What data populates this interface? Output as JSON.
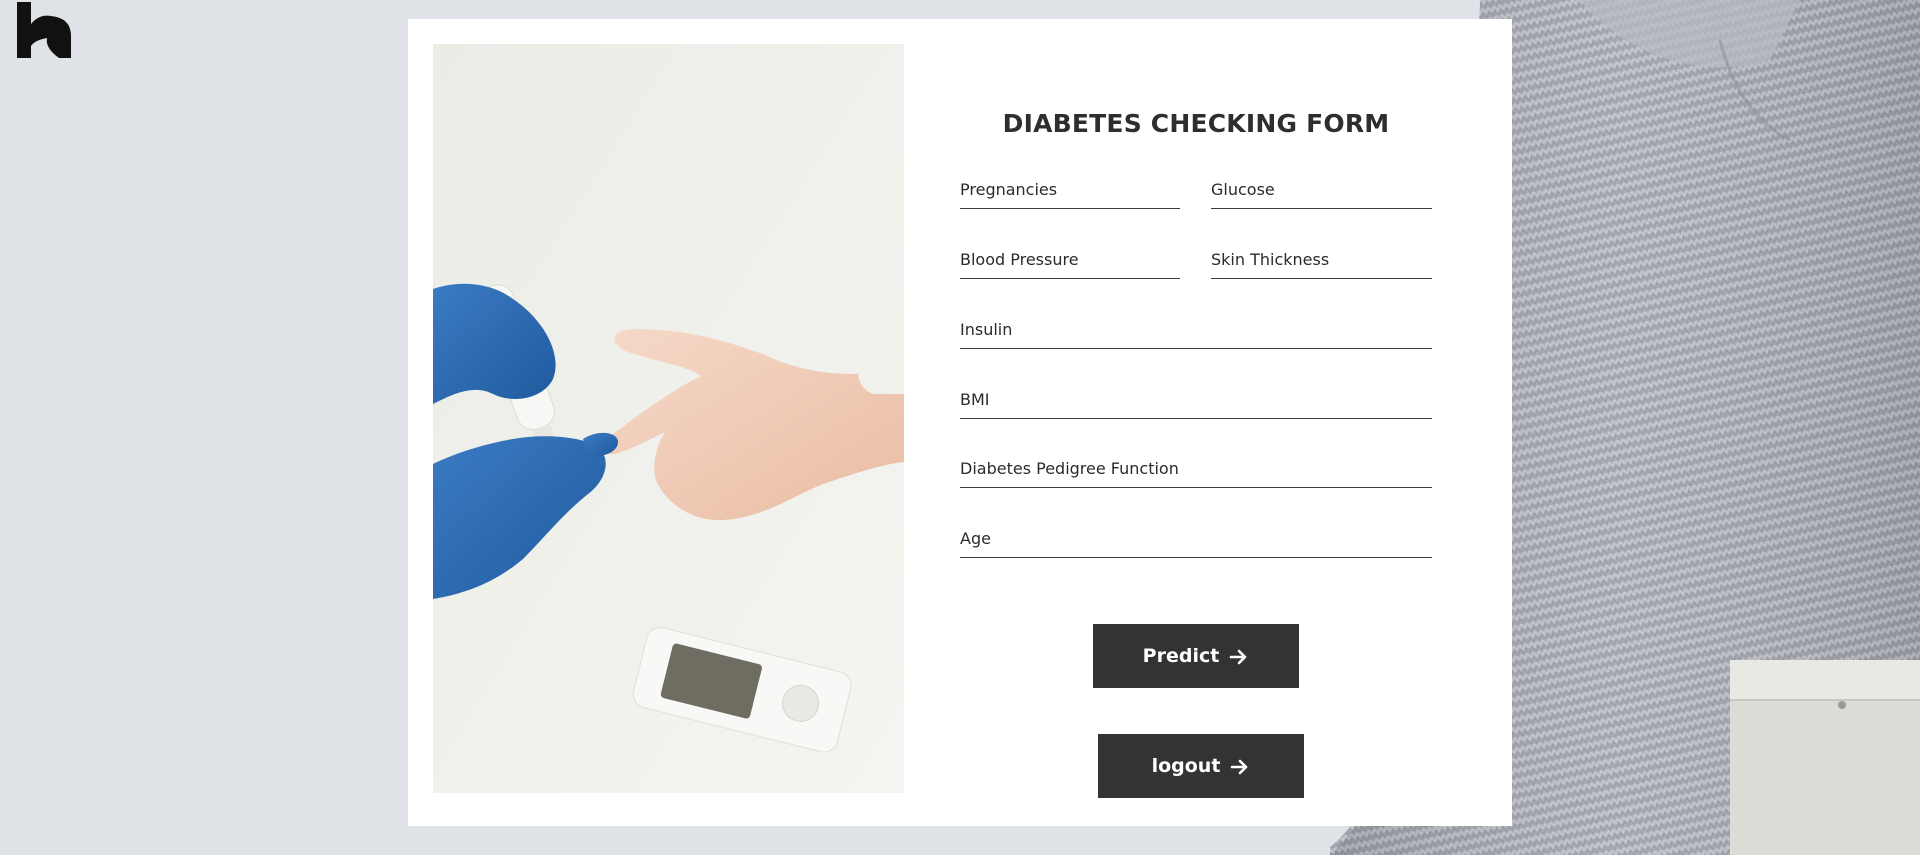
{
  "logo": {
    "icon": "brand-logo-icon"
  },
  "form": {
    "title": "DIABETES CHECKING FORM",
    "fields": {
      "pregnancies": {
        "label": "Pregnancies",
        "value": ""
      },
      "glucose": {
        "label": "Glucose",
        "value": ""
      },
      "blood_pressure": {
        "label": "Blood Pressure",
        "value": ""
      },
      "skin_thickness": {
        "label": "Skin Thickness",
        "value": ""
      },
      "insulin": {
        "label": "Insulin",
        "value": ""
      },
      "bmi": {
        "label": "BMI",
        "value": ""
      },
      "pedigree": {
        "label": "Diabetes Pedigree Function",
        "value": ""
      },
      "age": {
        "label": "Age",
        "value": ""
      }
    },
    "buttons": {
      "predict": "Predict",
      "logout": "logout"
    }
  },
  "colors": {
    "page_background": "#dfe3e8",
    "card_background": "#ffffff",
    "button_background": "#333333",
    "button_text": "#ffffff",
    "text": "#2e2e2e"
  }
}
